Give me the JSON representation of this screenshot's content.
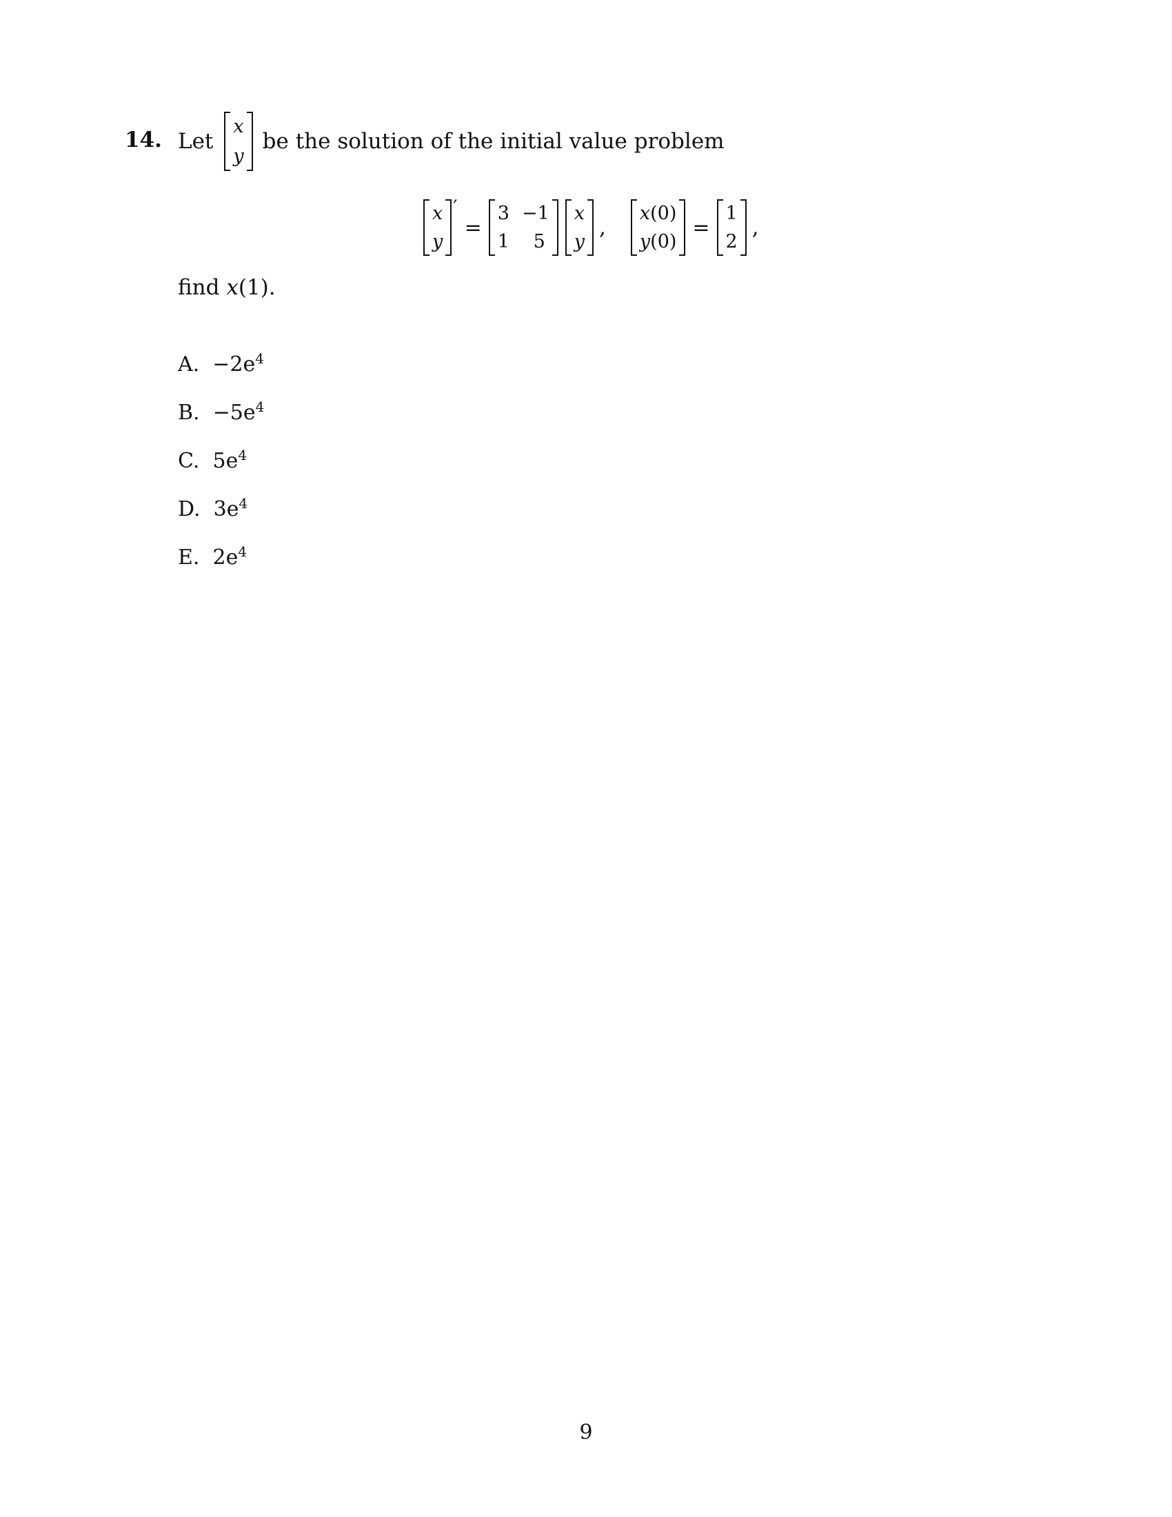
{
  "problem": {
    "number": "14.",
    "intro": "Let",
    "intro_vector": [
      "x",
      "y"
    ],
    "intro_rest": "be the solution of the initial value problem",
    "equation": {
      "lhs_vector": [
        "x",
        "y"
      ],
      "prime": "′",
      "equals": "=",
      "matrix_row1": [
        "3",
        "−1"
      ],
      "matrix_row2": [
        "1",
        "5"
      ],
      "rhs_vector": [
        "x",
        "y"
      ],
      "comma1": ",",
      "initial_vector": [
        "x(0)",
        "y(0)"
      ],
      "equals2": "=",
      "initial_values": [
        "1",
        "2"
      ],
      "comma2": ","
    },
    "find_prefix": "find ",
    "find_var": "x",
    "find_suffix": "(1)."
  },
  "choices": [
    {
      "label": "A.",
      "value": "−2e",
      "exp": "4"
    },
    {
      "label": "B.",
      "value": "−5e",
      "exp": "4"
    },
    {
      "label": "C.",
      "value": "5e",
      "exp": "4"
    },
    {
      "label": "D.",
      "value": "3e",
      "exp": "4"
    },
    {
      "label": "E.",
      "value": "2e",
      "exp": "4"
    }
  ],
  "page_number": "9"
}
